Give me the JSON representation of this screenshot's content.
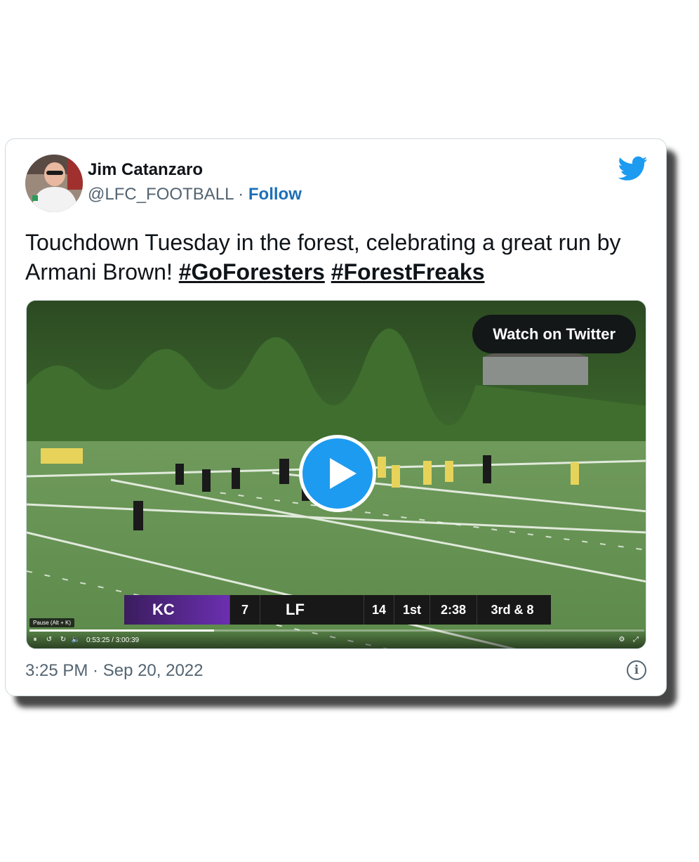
{
  "author": {
    "name": "Jim Catanzaro",
    "handle": "@LFC_FOOTBALL",
    "separator": "·",
    "follow_label": "Follow",
    "avatar_icon": "profile-photo"
  },
  "tweet": {
    "text": "Touchdown Tuesday in the forest, celebrating a great run by Armani Brown!",
    "hashtags": [
      "#GoForesters",
      "#ForestFreaks"
    ]
  },
  "media": {
    "watch_label": "Watch on Twitter",
    "play_icon": "play-icon",
    "scoreboard": {
      "team1": "KC",
      "team1_score": "7",
      "team2": "LF",
      "team2_score": "14",
      "quarter": "1st",
      "clock": "2:38",
      "down": "3rd & 8"
    },
    "player": {
      "tooltip": "Pause (Alt + K)",
      "time": "0:53:25 / 3:00:39",
      "progress": 0.3
    }
  },
  "footer": {
    "date": "3:25 PM · Sep 20, 2022",
    "info_icon": "info-icon"
  },
  "colors": {
    "follow": "#1d6fb8",
    "play": "#1d9bf0",
    "bird": "#1d9bf0",
    "team1": "#6b2fb0"
  }
}
